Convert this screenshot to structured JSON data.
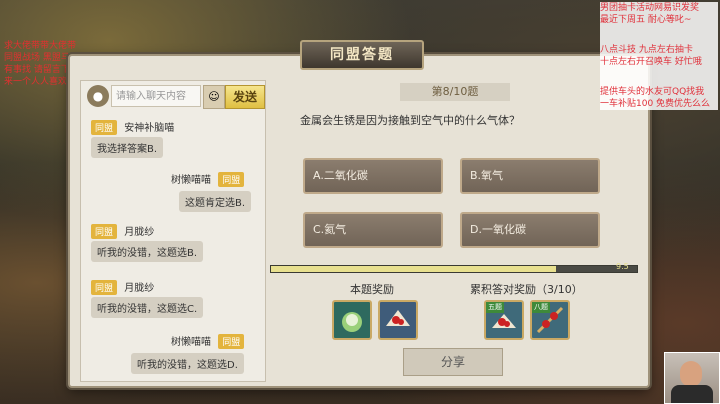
{
  "panel": {
    "title": "同盟答题"
  },
  "chat": {
    "input_placeholder": "请输入聊天内容",
    "send_label": "发送",
    "messages": [
      {
        "side": "left",
        "tag": "同盟",
        "name": "安神补脑喵",
        "text": "我选择答案B."
      },
      {
        "side": "right",
        "tag": "同盟",
        "name": "树懒喵喵",
        "text": "这题肯定选B."
      },
      {
        "side": "left",
        "tag": "同盟",
        "name": "月胧纱",
        "text": "听我的没错，这题选B."
      },
      {
        "side": "left",
        "tag": "同盟",
        "name": "月胧纱",
        "text": "听我的没错，这题选C."
      },
      {
        "side": "right",
        "tag": "同盟",
        "name": "树懒喵喵",
        "text": "听我的没错，这题选D."
      }
    ]
  },
  "quiz": {
    "number": "第8/10题",
    "question": "金属会生锈是因为接触到空气中的什么气体？",
    "options": [
      "A.二氧化碳",
      "B.氧气",
      "C.氦气",
      "D.一氧化碳"
    ],
    "progress": 0.78,
    "progress_label": "9.5",
    "reward_label": "本题奖励",
    "cumulative_label": "累积答对奖励（3/10）",
    "cumulative_tags": [
      "五题",
      "八题"
    ],
    "share_label": "分享"
  },
  "overlay": {
    "left_lines": [
      "求大佬带带大佬带",
      "同盟战场 黑盟马",
      "有事找 请留言下",
      "来一个人人喜欢8"
    ],
    "right_block1": [
      "男团抽卡活动网易识发奖",
      "最近下周五 耐心等叱~"
    ],
    "right_block2": [
      "八点斗技 九点左右抽卡",
      "十点左右开召唤车 好忙哦"
    ],
    "right_block3": [
      "提供车头的水友可QQ找我",
      "一车补贴100 免费优先么么"
    ]
  },
  "colors": {
    "accent": "#e3b43d",
    "panel_bg": "#e7e2d6",
    "option_bg": "#7d7062",
    "overlay_red": "#e23030"
  }
}
